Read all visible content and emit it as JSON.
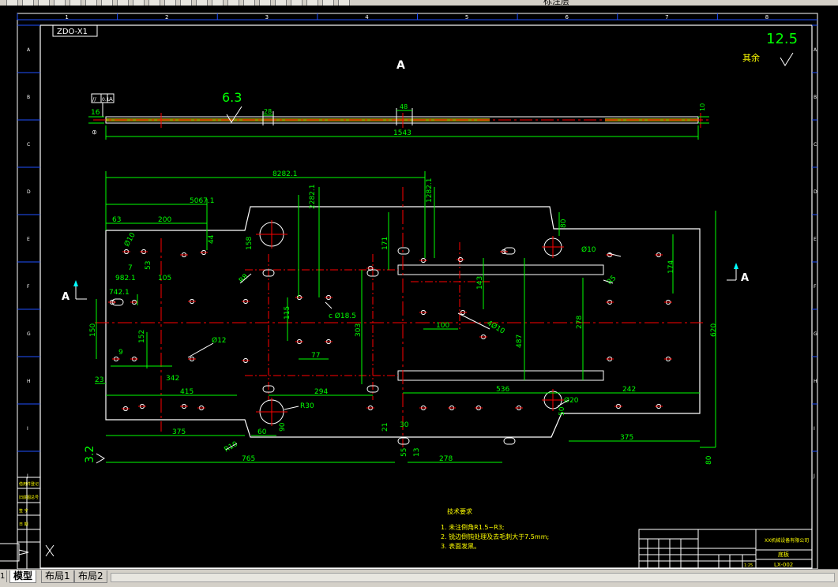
{
  "toolbar": {
    "title_text": "标注层",
    "buttons": [
      "new",
      "open",
      "save",
      "print",
      "preview",
      "cut",
      "copy",
      "paste",
      "match",
      "undo",
      "redo",
      "pan",
      "zoom-realtime",
      "zoom-window",
      "zoom-previous",
      "properties",
      "design-center",
      "tool-palette",
      "sheet-set",
      "markup",
      "calc",
      "help"
    ]
  },
  "drawing": {
    "sheet_id": "ZDO-X1",
    "roughness_general": "12.5",
    "roughness_general_label": "其余",
    "roughness_surface": "6.3",
    "roughness_side": "3.2",
    "section_label": "A",
    "section_marker_left": "A",
    "section_marker_right": "A",
    "grid_cols": [
      "1",
      "2",
      "3",
      "4",
      "5",
      "6",
      "7",
      "8"
    ],
    "grid_rows": [
      "A",
      "B",
      "C",
      "D",
      "E",
      "F",
      "G",
      "H",
      "I",
      "J"
    ],
    "tolerance_frame": [
      "//",
      "0.1",
      "A"
    ],
    "dims_top": {
      "thickness_left": "16",
      "slot1": "28",
      "slot2": "48",
      "thickness_right": "10",
      "overall_length": "1543"
    },
    "dims_plan": {
      "d8282": "8282.1",
      "d5067": "5067.1",
      "d2282": "2282.1",
      "d1282": "1282.1",
      "d63": "63",
      "d200": "200",
      "d44": "44",
      "d53": "53",
      "d158": "158",
      "d171": "171",
      "d80_top": "80",
      "d174": "174",
      "d7": "7",
      "d982": "982.1",
      "d105": "105",
      "d742": "742.1",
      "d150": "150",
      "d152": "152",
      "d9": "9",
      "d23": "23",
      "d342": "342",
      "d415": "415",
      "d294": "294",
      "d536": "536",
      "d242": "242",
      "d375_left": "375",
      "d60": "60",
      "d90": "90",
      "d765": "765",
      "d30": "30",
      "d21": "21",
      "d55": "55",
      "d13": "13",
      "d278_bottom": "278",
      "d375_right": "375",
      "d80_bottom": "80",
      "d50": "50",
      "d115": "115",
      "d77": "77",
      "d303": "303",
      "d487": "487",
      "d278_mid": "278",
      "d620": "620",
      "d143": "143",
      "d100": "100",
      "r8": "R8",
      "r10": "R10",
      "r30": "R30",
      "hole_r12": "Ø12",
      "hole_r10_left": "Ø10",
      "hole_r10_right": "Ø10",
      "hole_r10_mid": "4Ø10",
      "hole_r20": "Ø20",
      "hole_18": "c Ø18.5",
      "hole_r65": "R5"
    },
    "notes": {
      "title": "技术要求",
      "line1": "1. 未注倒角R1.5~R3;",
      "line2": "2. 锐边倒钝处理及去毛刺大于7.5mm;",
      "line3": "3. 表面发黑。"
    },
    "title_block": {
      "company": "XX机械设备有限公司",
      "part_name": "底板",
      "drawing_no": "LX-002",
      "scale": "1:25"
    },
    "left_strip": [
      "借用件登记",
      "旧底图总号",
      "签 字",
      "日 期"
    ]
  },
  "tabs": {
    "model": "模型",
    "layout1": "布局1",
    "layout2": "布局2"
  },
  "colors": {
    "background": "#000000",
    "frame": "#ffffff",
    "dimension": "#00ff00",
    "centerline": "#ff0000",
    "border_grid": "#1f4fff",
    "hatch": "#ffff00"
  }
}
